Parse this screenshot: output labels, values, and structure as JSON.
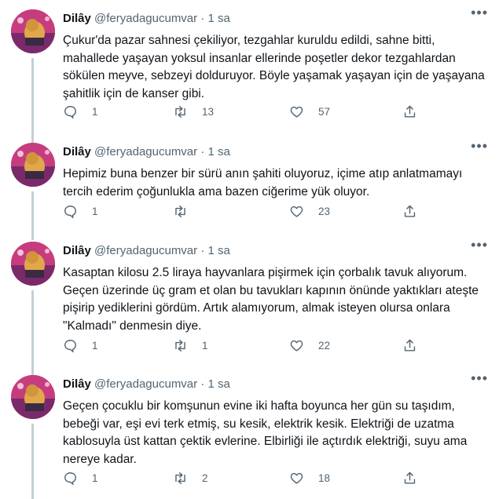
{
  "tweets": [
    {
      "name": "Dilây",
      "handle": "@feryadagucumvar",
      "dot": "·",
      "time": "1 sa",
      "more": "•••",
      "text": "Çukur'da pazar sahnesi çekiliyor, tezgahlar kuruldu edildi, sahne bitti, mahallede yaşayan yoksul insanlar ellerinde poşetler dekor tezgahlardan sökülen meyve, sebzeyi dolduruyor. Böyle yaşamak yaşayan için de yaşayana şahitlik için de kanser gibi.",
      "replies": "1",
      "retweets": "13",
      "likes": "57"
    },
    {
      "name": "Dilây",
      "handle": "@feryadagucumvar",
      "dot": "·",
      "time": "1 sa",
      "more": "•••",
      "text": "Hepimiz buna benzer bir sürü anın şahiti oluyoruz, içime atıp anlatmamayı tercih ederim çoğunlukla ama bazen ciğerime yük oluyor.",
      "replies": "1",
      "retweets": "",
      "likes": "23"
    },
    {
      "name": "Dilây",
      "handle": "@feryadagucumvar",
      "dot": "·",
      "time": "1 sa",
      "more": "•••",
      "text": "Kasaptan kilosu 2.5 liraya hayvanlara pişirmek için çorbalık tavuk alıyorum. Geçen üzerinde üç gram et olan bu tavukları kapının önünde yaktıkları ateşte pişirip yediklerini gördüm. Artık alamıyorum, almak isteyen olursa onlara \"Kalmadı\" denmesin diye.",
      "replies": "1",
      "retweets": "1",
      "likes": "22"
    },
    {
      "name": "Dilây",
      "handle": "@feryadagucumvar",
      "dot": "·",
      "time": "1 sa",
      "more": "•••",
      "text": "Geçen çocuklu bir komşunun evine iki hafta boyunca her gün su taşıdım, bebeği var, eşi evi terk etmiş, su kesik, elektrik kesik. Elektriği de uzatma kablosuyla üst kattan çektik evlerine. Elbirliği ile açtırdık elektriği, suyu ama nereye kadar.",
      "replies": "1",
      "retweets": "2",
      "likes": "18"
    }
  ],
  "icons": {
    "reply": "reply-icon",
    "retweet": "retweet-icon",
    "like": "heart-icon",
    "share": "share-icon",
    "more": "more-icon"
  }
}
